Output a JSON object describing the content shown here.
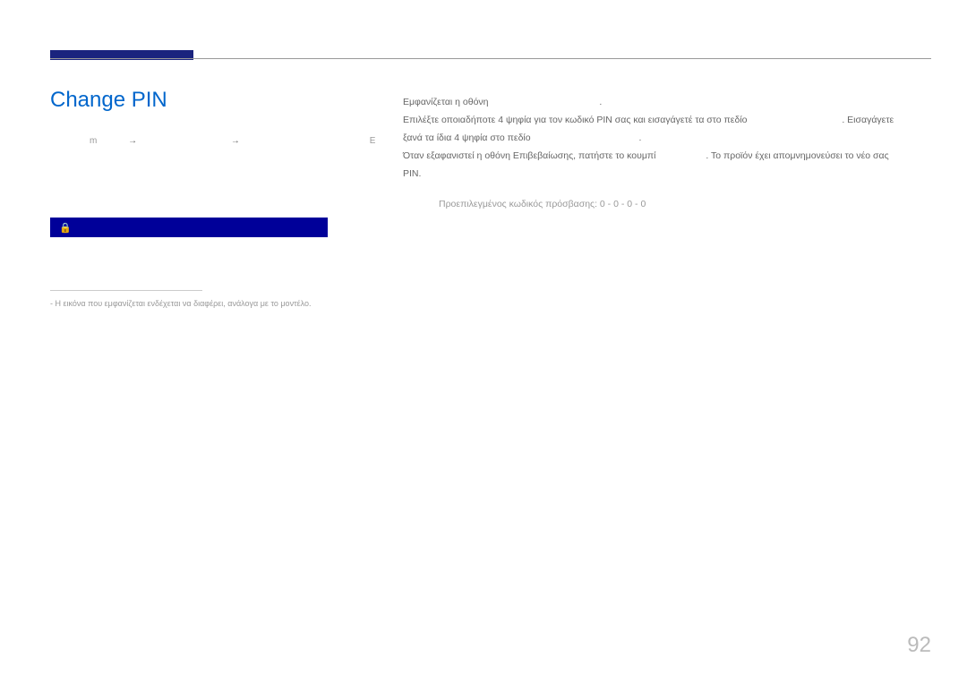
{
  "title": "Change PIN",
  "content": {
    "line1_a": "Εμφανίζεται η οθόνη",
    "line1_b": ".",
    "line2_a": "Επιλέξτε οποιαδήποτε 4 ψηφία για τον κωδικό PIN σας και εισαγάγετέ τα στο πεδίο",
    "line2_b": ". Εισαγάγετε",
    "line3_a": "ξανά τα ίδια 4 ψηφία στο πεδίο",
    "line3_b": ".",
    "line4_a": "Όταν εξαφανιστεί η οθόνη Επιβεβαίωσης, πατήστε το κουμπί",
    "line4_b": ". Το προϊόν έχει απομνημονεύσει το νέο σας",
    "line5": "PIN.",
    "default_pin": "Προεπιλεγμένος κωδικός πρόσβασης: 0 - 0 - 0 - 0"
  },
  "breadcrumb": {
    "m": "m",
    "arrow": "→",
    "end": "E"
  },
  "footnote": "- Η εικόνα που εμφανίζεται ενδέχεται να διαφέρει, ανάλογα με το μοντέλο.",
  "page_number": "92"
}
